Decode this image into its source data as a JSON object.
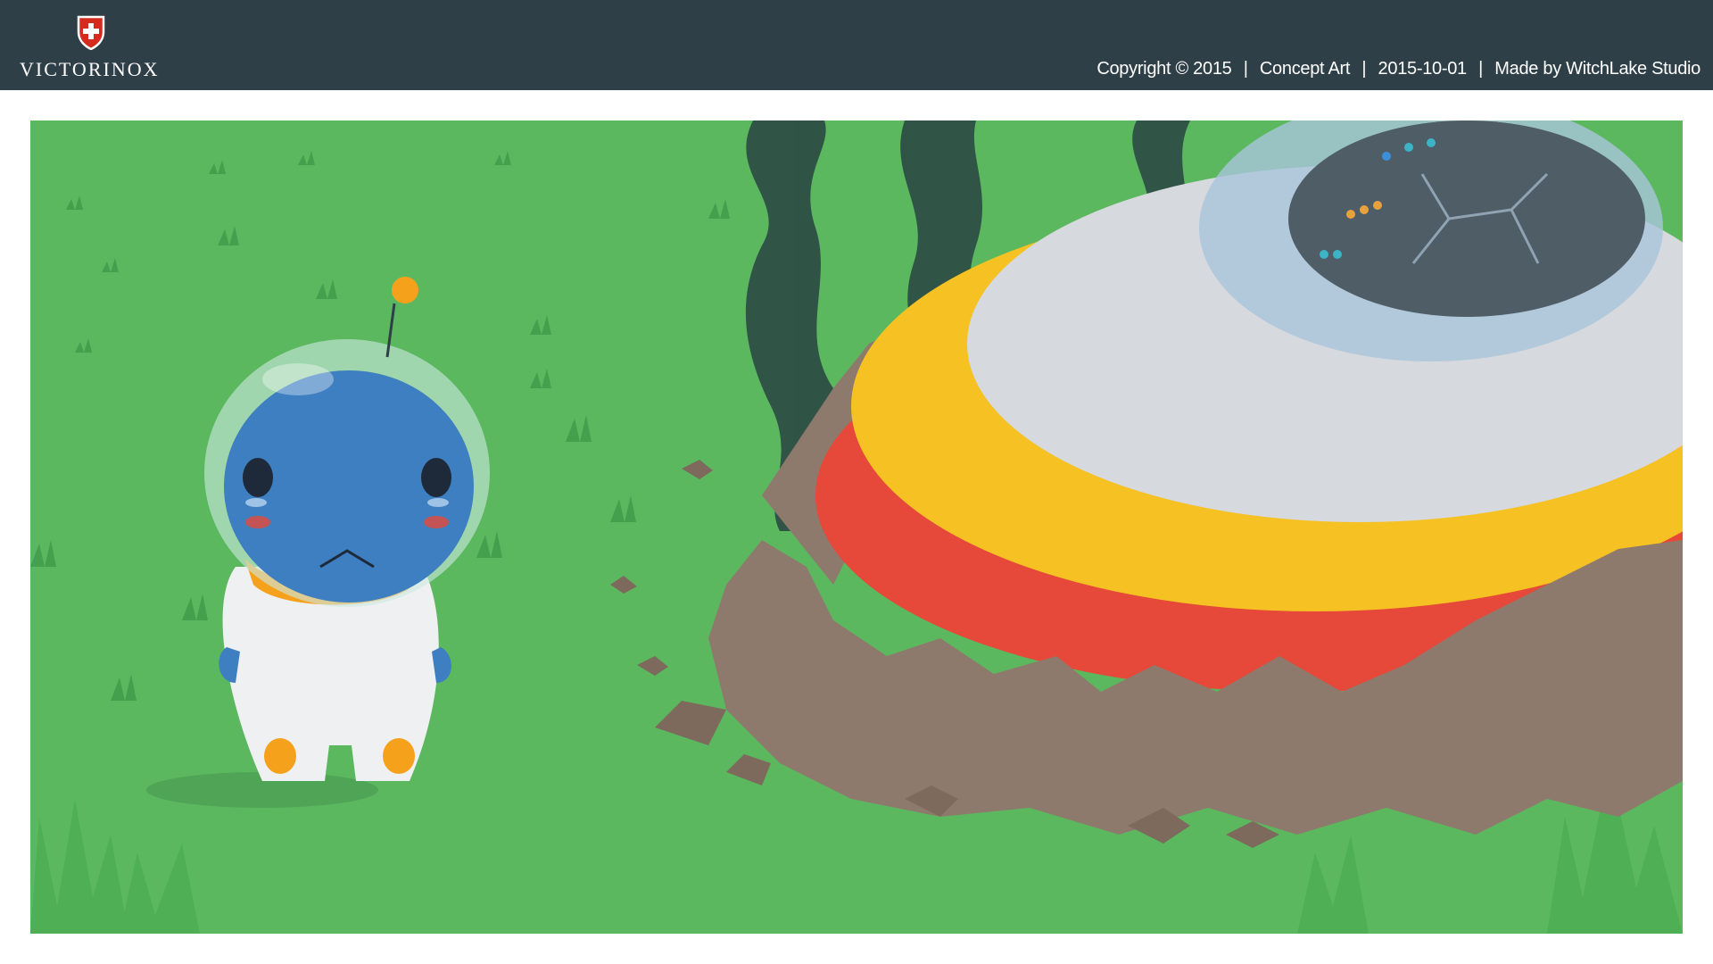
{
  "header": {
    "brand_name": "VICTORINOX",
    "brand_logo_icon": "swiss-cross-shield-icon",
    "meta": {
      "copyright": "Copyright © 2015",
      "category": "Concept Art",
      "date": "2015-10-01",
      "credit": "Made by WitchLake Studio"
    }
  },
  "colors": {
    "header_bg": "#2f3f48",
    "brand_red": "#d52b1e",
    "grass": "#5cb85f",
    "alien_blue": "#3d7fc0",
    "saucer_yellow": "#f6c123",
    "saucer_red": "#e6483a",
    "rock": "#8e7a6c",
    "smoke": "#2b4a44"
  }
}
